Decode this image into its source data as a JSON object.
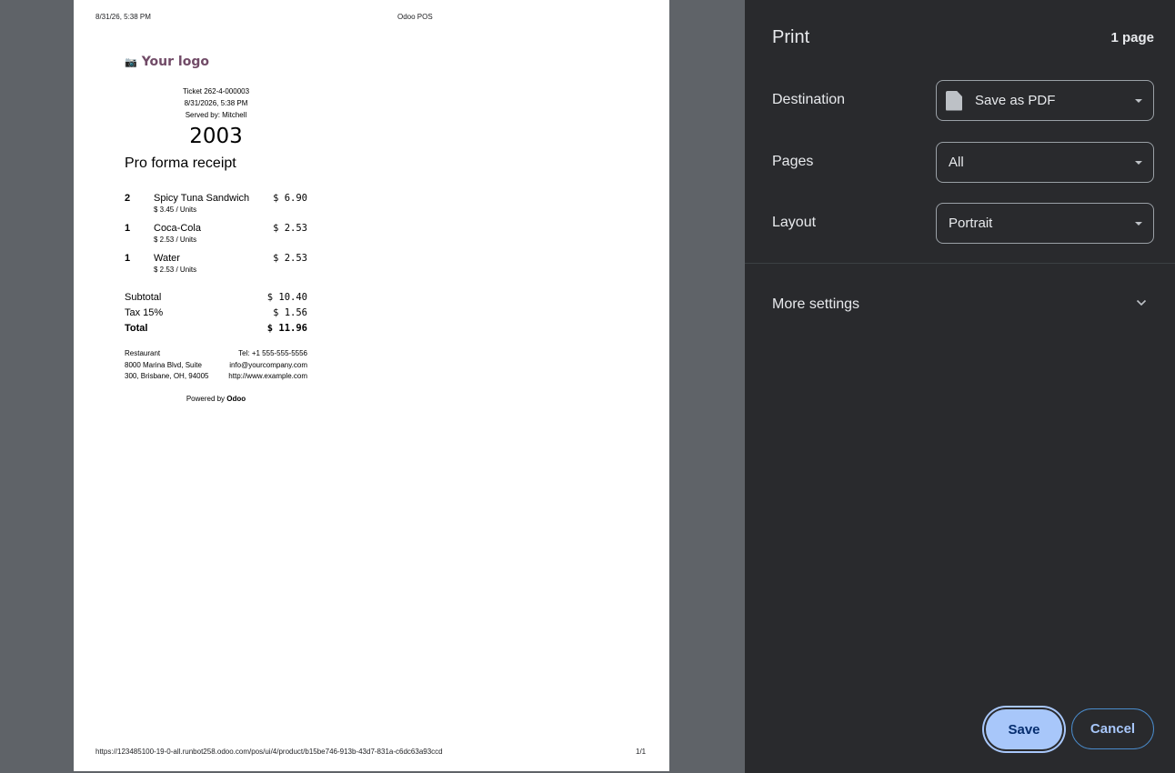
{
  "page_header": {
    "datetime": "8/31/26, 5:38 PM",
    "title": "Odoo POS"
  },
  "page_footer": {
    "url": "https://123485100-19-0-all.runbot258.odoo.com/pos/ui/4/product/b15be746-913b-43d7-831a-c6dc63a93ccd",
    "page_number": "1/1"
  },
  "receipt": {
    "logo_icon": "camera-icon",
    "logo_text": "Your logo",
    "ticket": "Ticket 262-4-000003",
    "datetime": "8/31/2026, 5:38 PM",
    "served_by": "Served by: Mitchell",
    "tracking_number": "2003",
    "title": "Pro forma receipt",
    "lines": [
      {
        "qty": "2",
        "name": "Spicy Tuna Sandwich",
        "price": "$ 6.90",
        "unit_price": "$ 3.45 / Units"
      },
      {
        "qty": "1",
        "name": "Coca-Cola",
        "price": "$ 2.53",
        "unit_price": "$ 2.53 / Units"
      },
      {
        "qty": "1",
        "name": "Water",
        "price": "$ 2.53",
        "unit_price": "$ 2.53 / Units"
      }
    ],
    "subtotal_label": "Subtotal",
    "subtotal_value": "$ 10.40",
    "tax_label": "Tax 15%",
    "tax_value": "$ 1.56",
    "total_label": "Total",
    "total_value": "$ 11.96",
    "company": {
      "name": "Restaurant",
      "address1": "8000 Marina Blvd, Suite",
      "address2": "300, Brisbane, OH, 94005",
      "phone": "Tel: +1 555-555-5556",
      "email": "info@yourcompany.com",
      "website": "http://www.example.com"
    },
    "powered_by": "Powered by",
    "powered_brand": "Odoo",
    "logo_color": "#714b67"
  },
  "print_panel": {
    "title": "Print",
    "page_count": "1 page",
    "destination_label": "Destination",
    "destination_value": "Save as PDF",
    "pages_label": "Pages",
    "pages_value": "All",
    "layout_label": "Layout",
    "layout_value": "Portrait",
    "more_settings": "More settings",
    "save_label": "Save",
    "cancel_label": "Cancel",
    "accent_color": "#a8c7fa",
    "background_color": "#292a2d"
  }
}
